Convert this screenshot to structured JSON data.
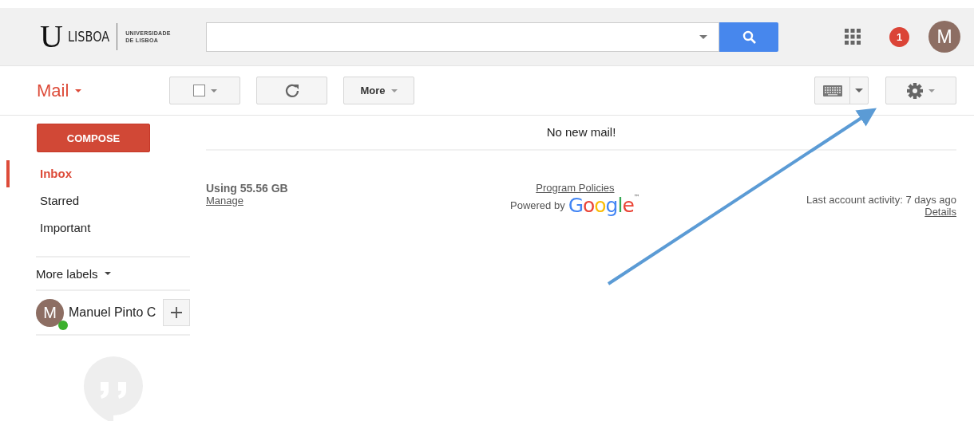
{
  "header": {
    "logo": {
      "mark": "U",
      "wordmark": "LISBOA",
      "subtitle_lines": [
        "UNIVERSIDADE",
        "DE LISBOA"
      ]
    },
    "notification_count": "1",
    "avatar_initial": "M"
  },
  "toolbar": {
    "app_menu": "Mail",
    "buttons": [
      {
        "kind": "select"
      },
      {
        "kind": "refresh"
      },
      {
        "kind": "more",
        "label": "More"
      }
    ]
  },
  "sidebar": {
    "compose": "COMPOSE",
    "items": [
      {
        "label": "Inbox",
        "selected": true
      },
      {
        "label": "Starred",
        "selected": false
      },
      {
        "label": "Important",
        "selected": false
      }
    ],
    "more_labels": "More labels",
    "account": {
      "initial": "M",
      "name": "Manuel Pinto C",
      "online": true
    }
  },
  "main": {
    "message": "No new mail!",
    "storage": "Using 55.56 GB",
    "manage": "Manage",
    "policies": "Program Policies",
    "powered_by": "Powered by",
    "brand": "Google",
    "trademark": "™",
    "activity": "Last account activity: 7 days ago",
    "details": "Details"
  }
}
